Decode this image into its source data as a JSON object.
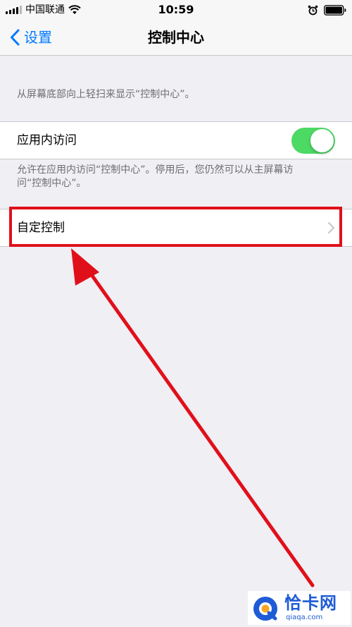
{
  "status_bar": {
    "carrier": "中国联通",
    "time": "10:59"
  },
  "nav": {
    "back_label": "设置",
    "title": "控制中心"
  },
  "intro_note": "从屏幕底部向上轻扫来显示“控制中心”。",
  "access_within_apps": {
    "label": "应用内访问",
    "toggle_on": true,
    "note": "允许在应用内访问“控制中心”。停用后，您仍然可以从主屏幕访问“控制中心”。"
  },
  "customize": {
    "label": "自定控制"
  },
  "colors": {
    "accent": "#007aff",
    "toggle_on": "#4cd964",
    "background": "#efeff4",
    "annotation": "#e0101a",
    "watermark": "#1e5bd6"
  },
  "icons": [
    "signal-icon",
    "wifi-icon",
    "alarm-icon",
    "battery-icon",
    "back-chevron-icon",
    "disclosure-chevron-icon"
  ],
  "watermark": {
    "name": "恰卡网",
    "domain": "qiaqa.com"
  }
}
